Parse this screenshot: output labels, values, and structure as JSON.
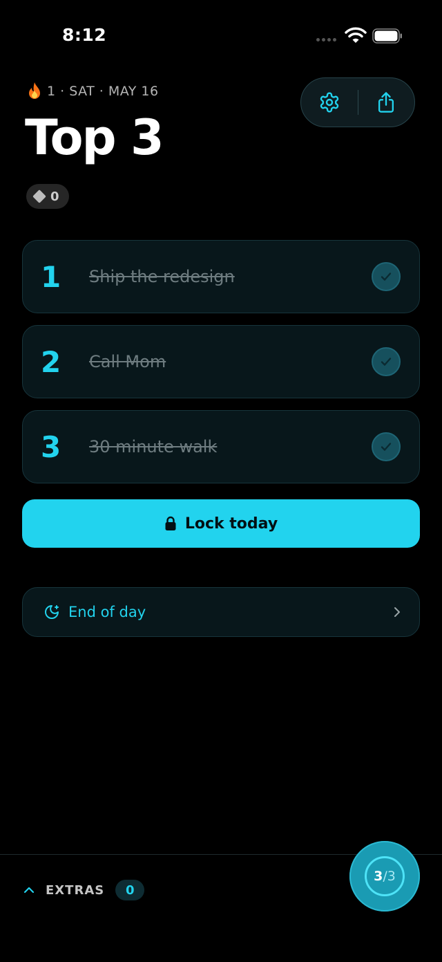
{
  "status_bar": {
    "time": "8:12"
  },
  "header": {
    "streak_text": "1 · SAT · MAY 16",
    "title": "Top 3",
    "gems": "0"
  },
  "tasks": [
    {
      "number": "1",
      "text": "Ship the redesign",
      "done": true
    },
    {
      "number": "2",
      "text": "Call Mom",
      "done": true
    },
    {
      "number": "3",
      "text": "30 minute walk",
      "done": true
    }
  ],
  "lock_button": {
    "label": "Lock today"
  },
  "end_of_day": {
    "label": "End of day"
  },
  "extras": {
    "label": "EXTRAS",
    "count": "0"
  },
  "progress": {
    "done": "3",
    "total": "/3"
  },
  "colors": {
    "accent": "#22d3ee",
    "background": "#000000",
    "card": "#08171b"
  },
  "icons": [
    "flame-icon",
    "gear-icon",
    "share-icon",
    "check-icon",
    "lock-icon",
    "moon-icon",
    "chevron-right-icon",
    "chevron-up-icon",
    "gem-icon"
  ]
}
